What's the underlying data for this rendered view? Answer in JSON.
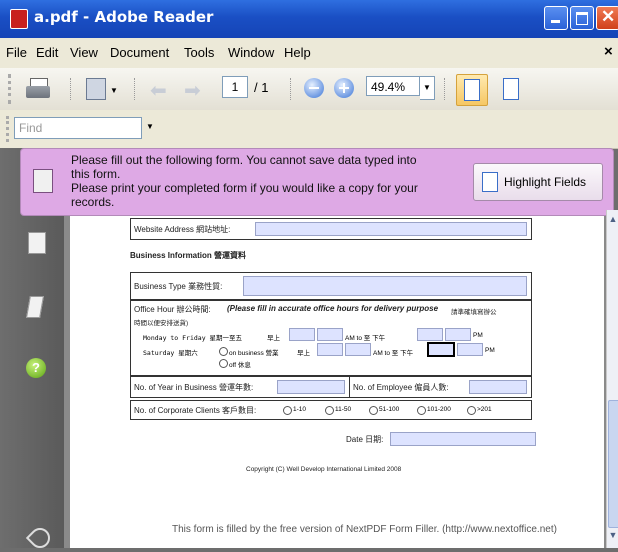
{
  "window": {
    "title": "a.pdf - Adobe Reader"
  },
  "menu": [
    "File",
    "Edit",
    "View",
    "Document",
    "Tools",
    "Window",
    "Help"
  ],
  "menu_close": "×",
  "toolbar": {
    "page_current": "1",
    "page_total": "/ 1",
    "zoom": "49.4%"
  },
  "find": {
    "placeholder": "Find"
  },
  "banner": {
    "message_line1": "Please fill out the following form. You cannot save data typed into",
    "message_line2": "this form.",
    "message_line3": "Please print your completed form if you would like a copy for your",
    "message_line4": "records.",
    "highlight_button": "Highlight Fields"
  },
  "form": {
    "website_label": "Website Address 網站地址:",
    "section_business": "Business Information 營運資料",
    "business_type_label": "Business Type 業務性質:",
    "office_hour_label": "Office Hour 辦公時間:",
    "office_hour_note": "(Please fill in accurate office hours for delivery purpose",
    "office_hour_note_cn1": "請準確填寫辦公",
    "office_hour_note_cn2": "時間以便安排送貨)",
    "weekday_label": "Monday to Friday 星期一至五",
    "saturday_label": "Saturday 星期六",
    "am_label": "早上",
    "am_to": "AM to 至 下午",
    "pm_label": "PM",
    "on_business": "on business 營業",
    "off_label": "off 休息",
    "years_label": "No. of Year in Business 營運年數:",
    "employee_label": "No. of Employee 僱員人數:",
    "clients_label": "No. of Corporate Clients 客戶數目:",
    "client_options": [
      "1-10",
      "11-50",
      "51-100",
      "101-200",
      ">201"
    ],
    "date_label": "Date 日期:",
    "copyright": "Copyright (C) Well Develop International Limited 2008",
    "footer": "This form is filled by the free version of NextPDF Form Filler. (http://www.nextoffice.net)"
  },
  "colors": {
    "titlebar": "#1a4fc4",
    "banner": "#dea9e5",
    "field": "#dde3ff",
    "help_icon": "#7ec21a"
  }
}
